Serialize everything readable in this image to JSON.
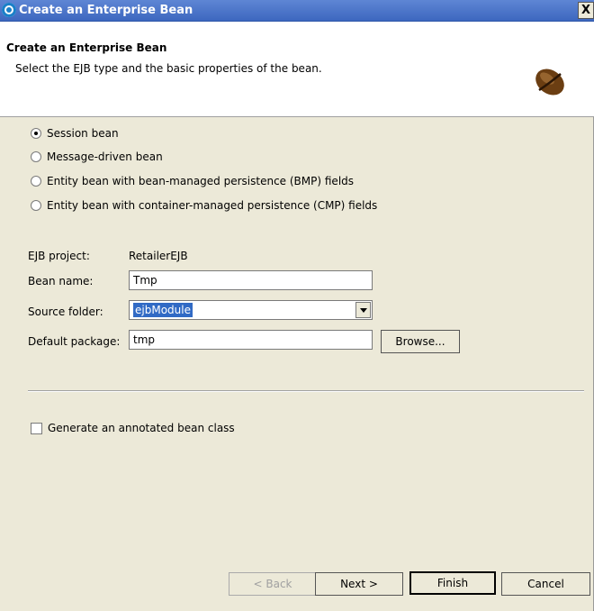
{
  "window": {
    "title": "Create an Enterprise Bean",
    "close_label": "X"
  },
  "header": {
    "title": "Create an Enterprise Bean",
    "description": "Select the EJB type and the basic properties of the bean."
  },
  "bean_types": [
    {
      "label": "Session bean",
      "selected": true
    },
    {
      "label": "Message-driven bean",
      "selected": false
    },
    {
      "label": "Entity bean with bean-managed persistence (BMP) fields",
      "selected": false
    },
    {
      "label": "Entity bean with container-managed persistence (CMP) fields",
      "selected": false
    }
  ],
  "form": {
    "ejb_project_label": "EJB project:",
    "ejb_project_value": "RetailerEJB",
    "bean_name_label": "Bean name:",
    "bean_name_value": "Tmp",
    "source_folder_label": "Source folder:",
    "source_folder_value": "ejbModule",
    "default_package_label": "Default package:",
    "default_package_value": "tmp",
    "browse_label": "Browse..."
  },
  "options": {
    "annotated_label": "Generate an annotated bean class",
    "annotated_checked": false
  },
  "buttons": {
    "back": "< Back",
    "next": "Next >",
    "finish": "Finish",
    "cancel": "Cancel"
  },
  "colors": {
    "titlebar": "#3d67bf",
    "selection": "#316ac5",
    "dialog_bg": "#ece9d8"
  }
}
